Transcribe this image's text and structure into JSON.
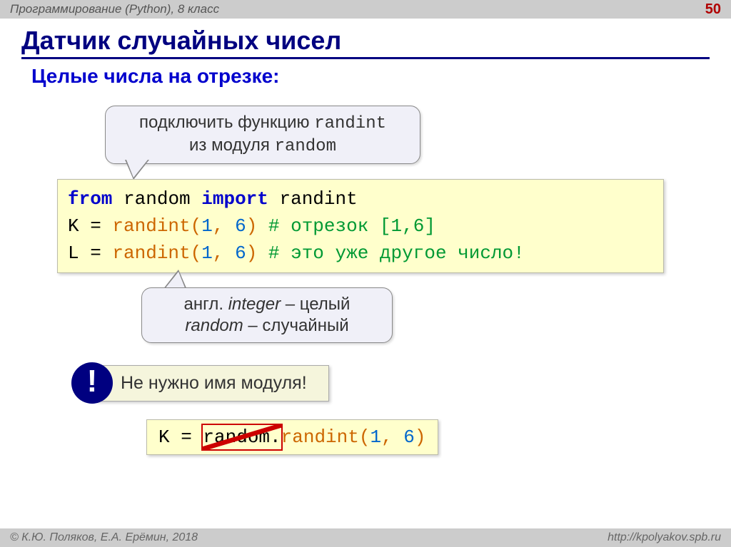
{
  "header": {
    "left": "Программирование (Python), 8 класс",
    "page": "50"
  },
  "title": "Датчик случайных чисел",
  "subtitle": "Целые числа на отрезке:",
  "callout_top": {
    "line1_a": "подключить функцию ",
    "line1_b": "randint",
    "line2_a": "из модуля ",
    "line2_b": "random"
  },
  "code": {
    "l1": {
      "from": "from",
      "sp1": " ",
      "mod": "random",
      "sp2": " ",
      "imp": "import",
      "sp3": " ",
      "fn": "randint"
    },
    "l2": {
      "var": "K",
      "eq": " = ",
      "fn": "randint",
      "lp": "(",
      "a": "1",
      "c": ",",
      "sp": " ",
      "b": "6",
      "rp": ")",
      "cmt": " # отрезок [1,6]"
    },
    "l3": {
      "var": "L",
      "eq": " = ",
      "fn": "randint",
      "lp": "(",
      "a": "1",
      "c": ",",
      "sp": " ",
      "b": "6",
      "rp": ")",
      "cmt": " # это уже другое число!"
    }
  },
  "callout_mid": {
    "line1_a": "англ. ",
    "line1_b": "integer",
    "line1_c": " – целый",
    "line2_a": "random",
    "line2_b": " – случайный"
  },
  "warn": {
    "badge": "!",
    "text": "Не нужно имя модуля!"
  },
  "code2": {
    "var": "K",
    "eq": " = ",
    "struck": "random.",
    "fn": "randint",
    "lp": "(",
    "a": "1",
    "c": ",",
    "sp": " ",
    "b": "6",
    "rp": ")"
  },
  "footer": {
    "left": "© К.Ю. Поляков, Е.А. Ерёмин, 2018",
    "right": "http://kpolyakov.spb.ru"
  }
}
